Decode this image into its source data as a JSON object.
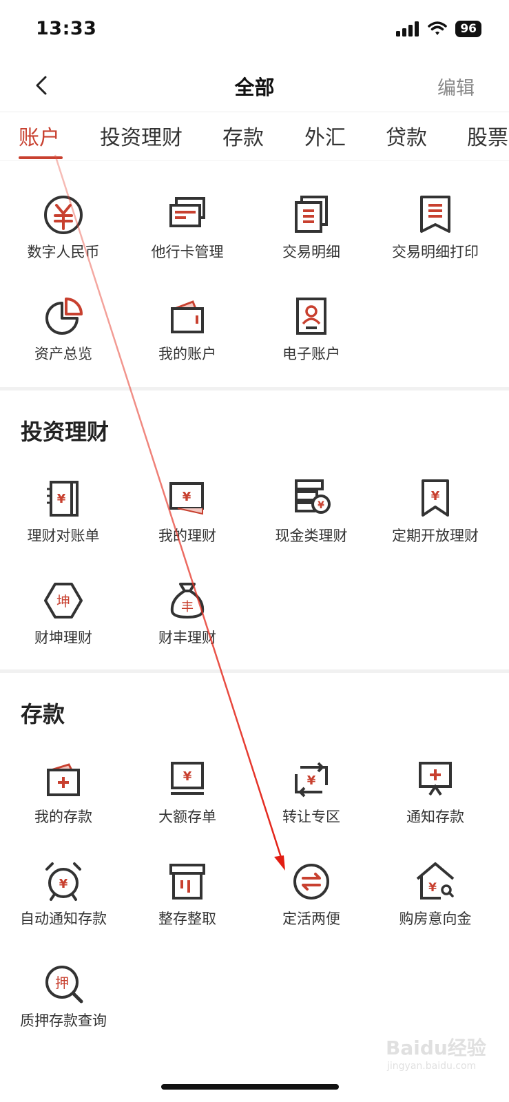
{
  "status_bar": {
    "time": "13:33",
    "battery": "96"
  },
  "nav": {
    "title": "全部",
    "edit_label": "编辑"
  },
  "tabs": [
    {
      "label": "账户",
      "active": true
    },
    {
      "label": "投资理财"
    },
    {
      "label": "存款"
    },
    {
      "label": "外汇"
    },
    {
      "label": "贷款"
    },
    {
      "label": "股票"
    }
  ],
  "accounts": {
    "items": [
      {
        "label": "数字人民币",
        "icon": "digital-rmb-icon"
      },
      {
        "label": "他行卡管理",
        "icon": "cards-icon"
      },
      {
        "label": "交易明细",
        "icon": "transaction-detail-icon"
      },
      {
        "label": "交易明细打印",
        "icon": "receipt-icon"
      },
      {
        "label": "资产总览",
        "icon": "pie-chart-icon"
      },
      {
        "label": "我的账户",
        "icon": "wallet-icon"
      },
      {
        "label": "电子账户",
        "icon": "user-card-icon"
      }
    ]
  },
  "wealth": {
    "title": "投资理财",
    "items": [
      {
        "label": "理财对账单",
        "icon": "statement-book-icon"
      },
      {
        "label": "我的理财",
        "icon": "my-wealth-icon"
      },
      {
        "label": "现金类理财",
        "icon": "cash-wealth-icon"
      },
      {
        "label": "定期开放理财",
        "icon": "bookmark-yuan-icon"
      },
      {
        "label": "财坤理财",
        "icon": "hexagon-kun-icon",
        "glyph": "坤"
      },
      {
        "label": "财丰理财",
        "icon": "money-bag-icon",
        "glyph": "丰"
      }
    ]
  },
  "deposits": {
    "title": "存款",
    "items": [
      {
        "label": "我的存款",
        "icon": "my-deposit-icon"
      },
      {
        "label": "大额存单",
        "icon": "large-cd-icon"
      },
      {
        "label": "转让专区",
        "icon": "transfer-zone-icon"
      },
      {
        "label": "通知存款",
        "icon": "notice-deposit-icon"
      },
      {
        "label": "自动通知存款",
        "icon": "alarm-clock-icon"
      },
      {
        "label": "整存整取",
        "icon": "box-icon"
      },
      {
        "label": "定活两便",
        "icon": "exchange-icon"
      },
      {
        "label": "购房意向金",
        "icon": "house-search-icon"
      },
      {
        "label": "质押存款查询",
        "icon": "pledge-search-icon",
        "glyph": "押"
      }
    ]
  },
  "watermark": {
    "text": "Baidu经验",
    "url": "jingyan.baidu.com"
  },
  "colors": {
    "accent": "#c8402f",
    "icon_dark": "#333333",
    "divider": "#f1f1f1"
  }
}
